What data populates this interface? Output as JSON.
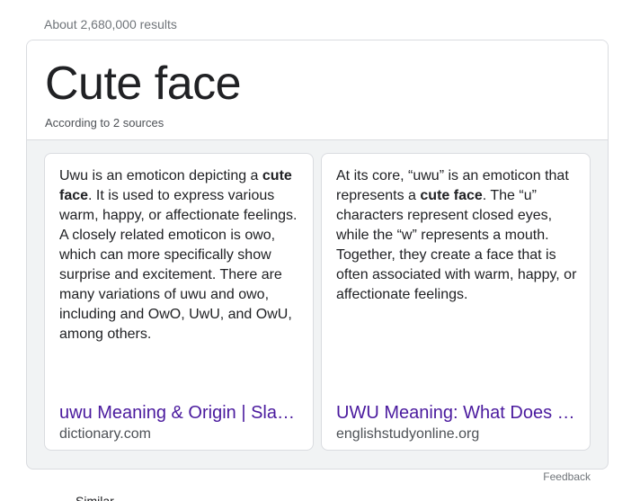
{
  "result_stats": "About 2,680,000 results",
  "card": {
    "title": "Cute face",
    "subtitle": "According to 2 sources"
  },
  "sources": [
    {
      "snippet_parts": {
        "before": "Uwu is an emoticon depicting a ",
        "bold": "cute face",
        "after": ". It is used to express various warm, happy, or affectionate feelings. A closely related emoticon is owo, which can more specifically show surprise and excitement. There are many variations of uwu and owo, including and OwO, UwU, and OwU, among others."
      },
      "link_title": "uwu Meaning & Origin | Slang by Dictionary.com",
      "domain": "dictionary.com"
    },
    {
      "snippet_parts": {
        "before": "At its core, “uwu” is an emoticon that represents a ",
        "bold": "cute face",
        "after": ". The “u” characters represent closed eyes, while the “w” represents a mouth. Together, they create a face that is often associated with warm, happy, or affectionate feelings."
      },
      "link_title": "UWU Meaning: What Does UWU Mean?",
      "domain": "englishstudyonline.org"
    }
  ],
  "feedback_label": "Feedback",
  "cut_off_text": "Similar"
}
